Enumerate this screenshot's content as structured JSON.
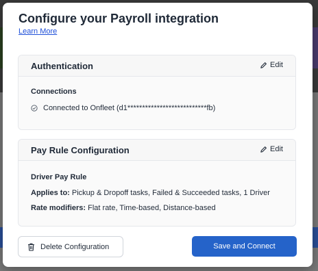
{
  "modal": {
    "title": "Configure your Payroll integration",
    "learn_more": "Learn More"
  },
  "authentication": {
    "title": "Authentication",
    "edit_label": "Edit",
    "connections_label": "Connections",
    "connection_status": "Connected to Onfleet (d1***************************fb)"
  },
  "pay_rule": {
    "title": "Pay Rule Configuration",
    "edit_label": "Edit",
    "rule_name": "Driver Pay Rule",
    "applies_to_label": "Applies to:",
    "applies_to_value": " Pickup & Dropoff tasks, Failed & Succeeded tasks, 1 Driver",
    "rate_modifiers_label": "Rate modifiers:",
    "rate_modifiers_value": " Flat rate, Time-based, Distance-based"
  },
  "footer": {
    "delete_label": "Delete Configuration",
    "save_label": "Save and Connect"
  },
  "colors": {
    "primary": "#2563c9",
    "link": "#1d4ed8"
  },
  "icons": [
    "pencil-icon",
    "check-circle-icon",
    "trash-icon"
  ]
}
